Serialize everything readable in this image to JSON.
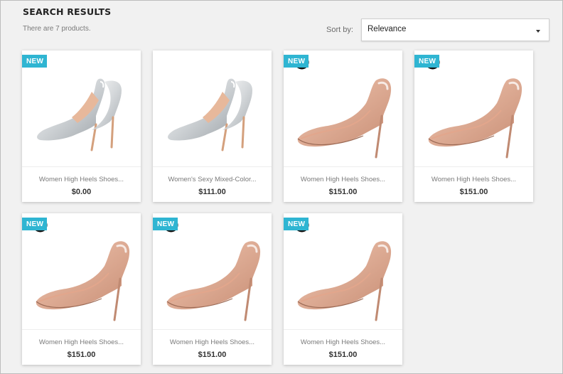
{
  "page": {
    "title": "SEARCH RESULTS",
    "count_text": "There are 7 products."
  },
  "sort": {
    "label": "Sort by:",
    "selected": "Relevance"
  },
  "colors": {
    "accent": "#2fb5d2",
    "background": "#f1f1f1"
  },
  "products": [
    {
      "name": "Women High Heels Shoes...",
      "price": "$0.00",
      "flag": "NEW",
      "image": "silver-pump",
      "loading_icon": false
    },
    {
      "name": "Women's Sexy Mixed-Color...",
      "price": "$111.00",
      "flag": "",
      "image": "silver-pump",
      "loading_icon": false
    },
    {
      "name": "Women High Heels Shoes...",
      "price": "$151.00",
      "flag": "NEW",
      "image": "nude-pump",
      "loading_icon": true
    },
    {
      "name": "Women High Heels Shoes...",
      "price": "$151.00",
      "flag": "NEW",
      "image": "nude-pump",
      "loading_icon": true
    },
    {
      "name": "Women High Heels Shoes...",
      "price": "$151.00",
      "flag": "NEW",
      "image": "nude-pump",
      "loading_icon": true
    },
    {
      "name": "Women High Heels Shoes...",
      "price": "$151.00",
      "flag": "NEW",
      "image": "nude-pump",
      "loading_icon": true
    },
    {
      "name": "Women High Heels Shoes...",
      "price": "$151.00",
      "flag": "NEW",
      "image": "nude-pump",
      "loading_icon": true
    }
  ]
}
